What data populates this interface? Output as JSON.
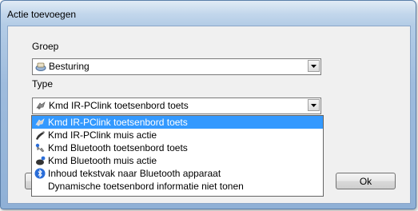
{
  "window": {
    "title": "Actie toevoegen"
  },
  "group": {
    "label": "Groep",
    "selected": "Besturing",
    "icon": "steering-wheel-icon"
  },
  "type": {
    "label": "Type",
    "selected": "Kmd IR-PClink toetsenbord toets",
    "icon": "ir-keyboard-icon",
    "options": [
      {
        "label": "Kmd IR-PClink toetsenbord toets",
        "icon": "ir-keyboard-icon",
        "selected": true
      },
      {
        "label": "Kmd IR-PClink muis actie",
        "icon": "ir-mouse-icon",
        "selected": false
      },
      {
        "label": "Kmd Bluetooth toetsenbord toets",
        "icon": "bluetooth-keyboard-icon",
        "selected": false
      },
      {
        "label": "Kmd Bluetooth muis actie",
        "icon": "bluetooth-mouse-icon",
        "selected": false
      },
      {
        "label": "Inhoud tekstvak naar Bluetooth apparaat",
        "icon": "bluetooth-icon",
        "selected": false
      },
      {
        "label": "Dynamische toetsenbord informatie niet tonen",
        "icon": "",
        "selected": false
      }
    ]
  },
  "buttons": {
    "ok": "Ok"
  },
  "colors": {
    "selection": "#3399ff",
    "frame": "#9fbcdd",
    "dialog_bg": "#f0f0f0"
  }
}
